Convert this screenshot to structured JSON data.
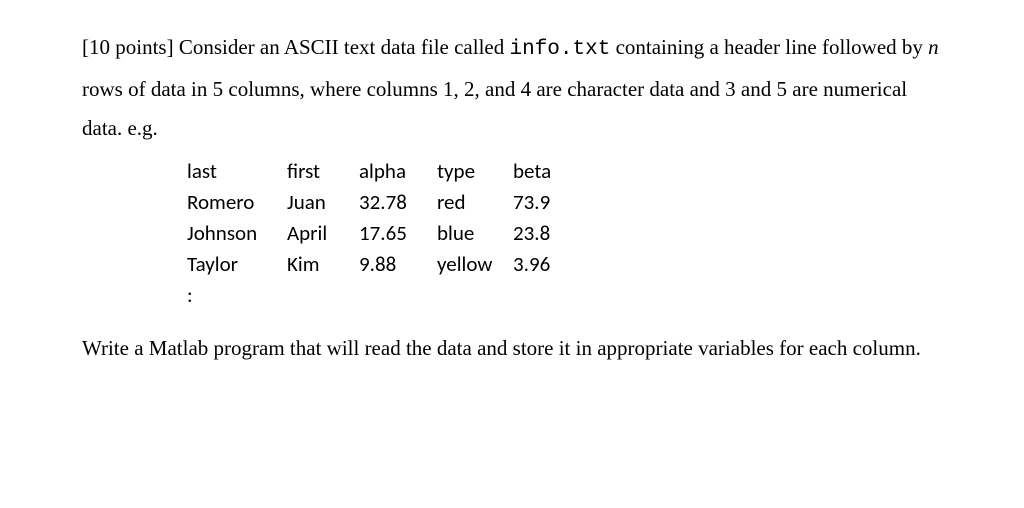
{
  "problem": {
    "points_label": "[10 points]",
    "intro_part1": " Consider an ASCII text data file called ",
    "filename": "info.txt",
    "intro_part2": " containing a header line followed by ",
    "nvar": "n",
    "intro_part3": " rows of data in 5 columns, where columns 1, 2, and 4 are character data and 3 and 5 are numerical data. e.g."
  },
  "table": {
    "header": {
      "c1": "last",
      "c2": "first",
      "c3": "alpha",
      "c4": "type",
      "c5": "beta"
    },
    "rows": [
      {
        "c1": "Romero",
        "c2": "Juan",
        "c3": "32.78",
        "c4": "red",
        "c5": "73.9"
      },
      {
        "c1": "Johnson",
        "c2": "April",
        "c3": "17.65",
        "c4": "blue",
        "c5": "23.8"
      },
      {
        "c1": "Taylor",
        "c2": "Kim",
        "c3": "9.88",
        "c4": "yellow",
        "c5": "3.96"
      }
    ],
    "ellipsis": ":"
  },
  "task": "Write a Matlab program that will read the data and store it in appropriate variables for each column."
}
